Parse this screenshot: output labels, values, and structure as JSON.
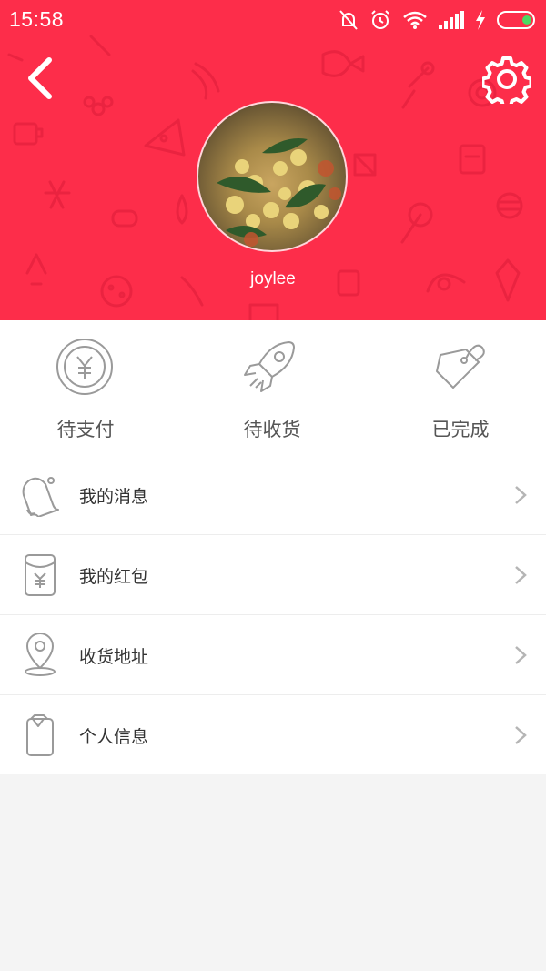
{
  "status_bar": {
    "time": "15:58"
  },
  "profile": {
    "username": "joylee"
  },
  "orders": [
    {
      "label": "待支付",
      "icon": "yen-coin-icon"
    },
    {
      "label": "待收货",
      "icon": "rocket-icon"
    },
    {
      "label": "已完成",
      "icon": "tag-icon"
    }
  ],
  "menu": [
    {
      "label": "我的消息",
      "icon": "bell-icon"
    },
    {
      "label": "我的红包",
      "icon": "red-envelope-icon"
    },
    {
      "label": "收货地址",
      "icon": "location-pin-icon"
    },
    {
      "label": "个人信息",
      "icon": "phone-info-icon"
    }
  ],
  "colors": {
    "header_red": "#fd2d4a",
    "icon_gray": "#9a9a9a",
    "background": "#f4f4f4"
  }
}
